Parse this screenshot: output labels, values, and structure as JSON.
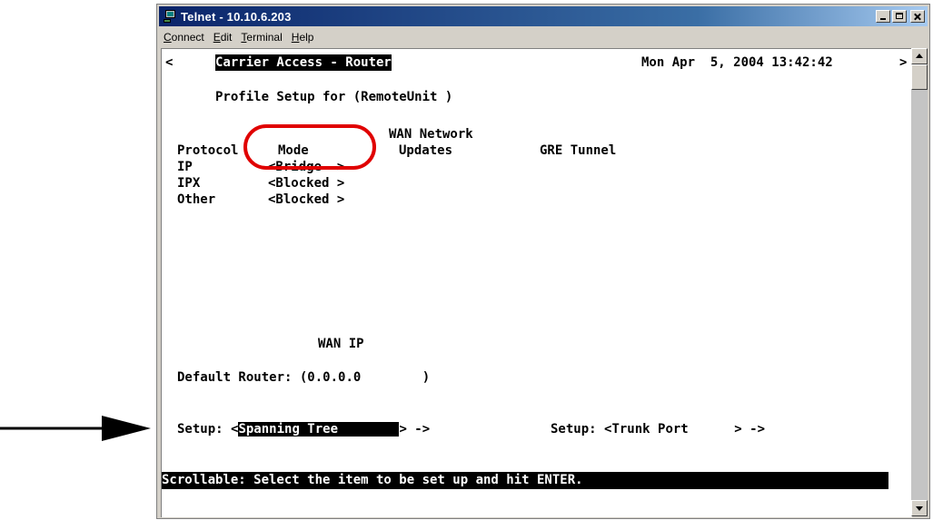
{
  "window": {
    "title": "Telnet - 10.10.6.203"
  },
  "menu": {
    "connect": {
      "key": "C",
      "rest": "onnect"
    },
    "edit": {
      "key": "E",
      "rest": "dit"
    },
    "terminal": {
      "key": "T",
      "rest": "erminal"
    },
    "help": {
      "key": "H",
      "rest": "elp"
    }
  },
  "terminal": {
    "header": {
      "left_arrow": "<",
      "app_name": "Carrier Access - Router",
      "datetime": "Mon Apr  5, 2004 13:42:42",
      "right_arrow": ">"
    },
    "profile_title": "Profile Setup for (RemoteUnit )",
    "columns": {
      "protocol": "Protocol",
      "mode": "Mode",
      "wan_network_line1": "WAN Network",
      "wan_network_line2": "Updates",
      "gre_tunnel": "GRE Tunnel"
    },
    "rows": [
      {
        "protocol": "IP",
        "mode": "<Bridge  >"
      },
      {
        "protocol": "IPX",
        "mode": "<Blocked >"
      },
      {
        "protocol": "Other",
        "mode": "<Blocked >"
      }
    ],
    "wan_ip_heading": "WAN IP",
    "default_router": {
      "label": "Default Router: (",
      "value": "0.0.0.0",
      "close": "        )"
    },
    "setup1": {
      "label": "Setup: <",
      "value": "Spanning Tree        ",
      "suffix": "> ->"
    },
    "setup2": {
      "label": "Setup: <",
      "value": "Trunk Port      ",
      "suffix": "> ->"
    },
    "status_bar": "Scrollable: Select the item to be set up and hit ENTER."
  },
  "colors": {
    "annotation_circle": "#e00000",
    "title_bar": "#0a246a",
    "terminal_bg": "#ffffff"
  },
  "icons": {
    "arrow": "right-arrow-icon",
    "app": "telnet-app-icon"
  }
}
